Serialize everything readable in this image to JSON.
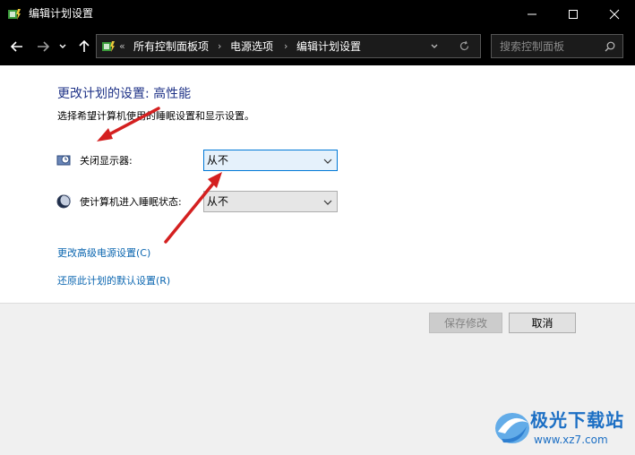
{
  "window": {
    "title": "编辑计划设置",
    "buttons": {
      "minimize_icon": "minimize-icon",
      "maximize_icon": "maximize-icon",
      "close_icon": "close-icon"
    }
  },
  "nav": {
    "back_icon": "back-arrow-icon",
    "forward_icon": "forward-arrow-icon",
    "recent_icon": "chevron-down-icon",
    "up_icon": "up-arrow-icon"
  },
  "address": {
    "overflow": "«",
    "crumbs": [
      "所有控制面板项",
      "电源选项",
      "编辑计划设置"
    ],
    "separator": "›",
    "refresh_icon": "refresh-icon",
    "dropdown_icon": "chevron-down-icon"
  },
  "search": {
    "placeholder": "搜索控制面板",
    "icon": "search-icon"
  },
  "main": {
    "heading": "更改计划的设置: 高性能",
    "description": "选择希望计算机使用的睡眠设置和显示设置。",
    "settings": [
      {
        "label": "关闭显示器:",
        "value": "从不",
        "icon": "display-clock-icon"
      },
      {
        "label": "使计算机进入睡眠状态:",
        "value": "从不",
        "icon": "moon-icon"
      }
    ],
    "links": [
      "更改高级电源设置(C)",
      "还原此计划的默认设置(R)"
    ]
  },
  "footer": {
    "save_label": "保存修改",
    "cancel_label": "取消"
  },
  "watermark": {
    "name": "极光下载站",
    "url": "www.xz7.com"
  },
  "colors": {
    "titlebar": "#000000",
    "heading": "#1e3287",
    "link": "#0b66b0",
    "annotation_arrow": "#d42020",
    "selected_border": "#0078d7"
  }
}
